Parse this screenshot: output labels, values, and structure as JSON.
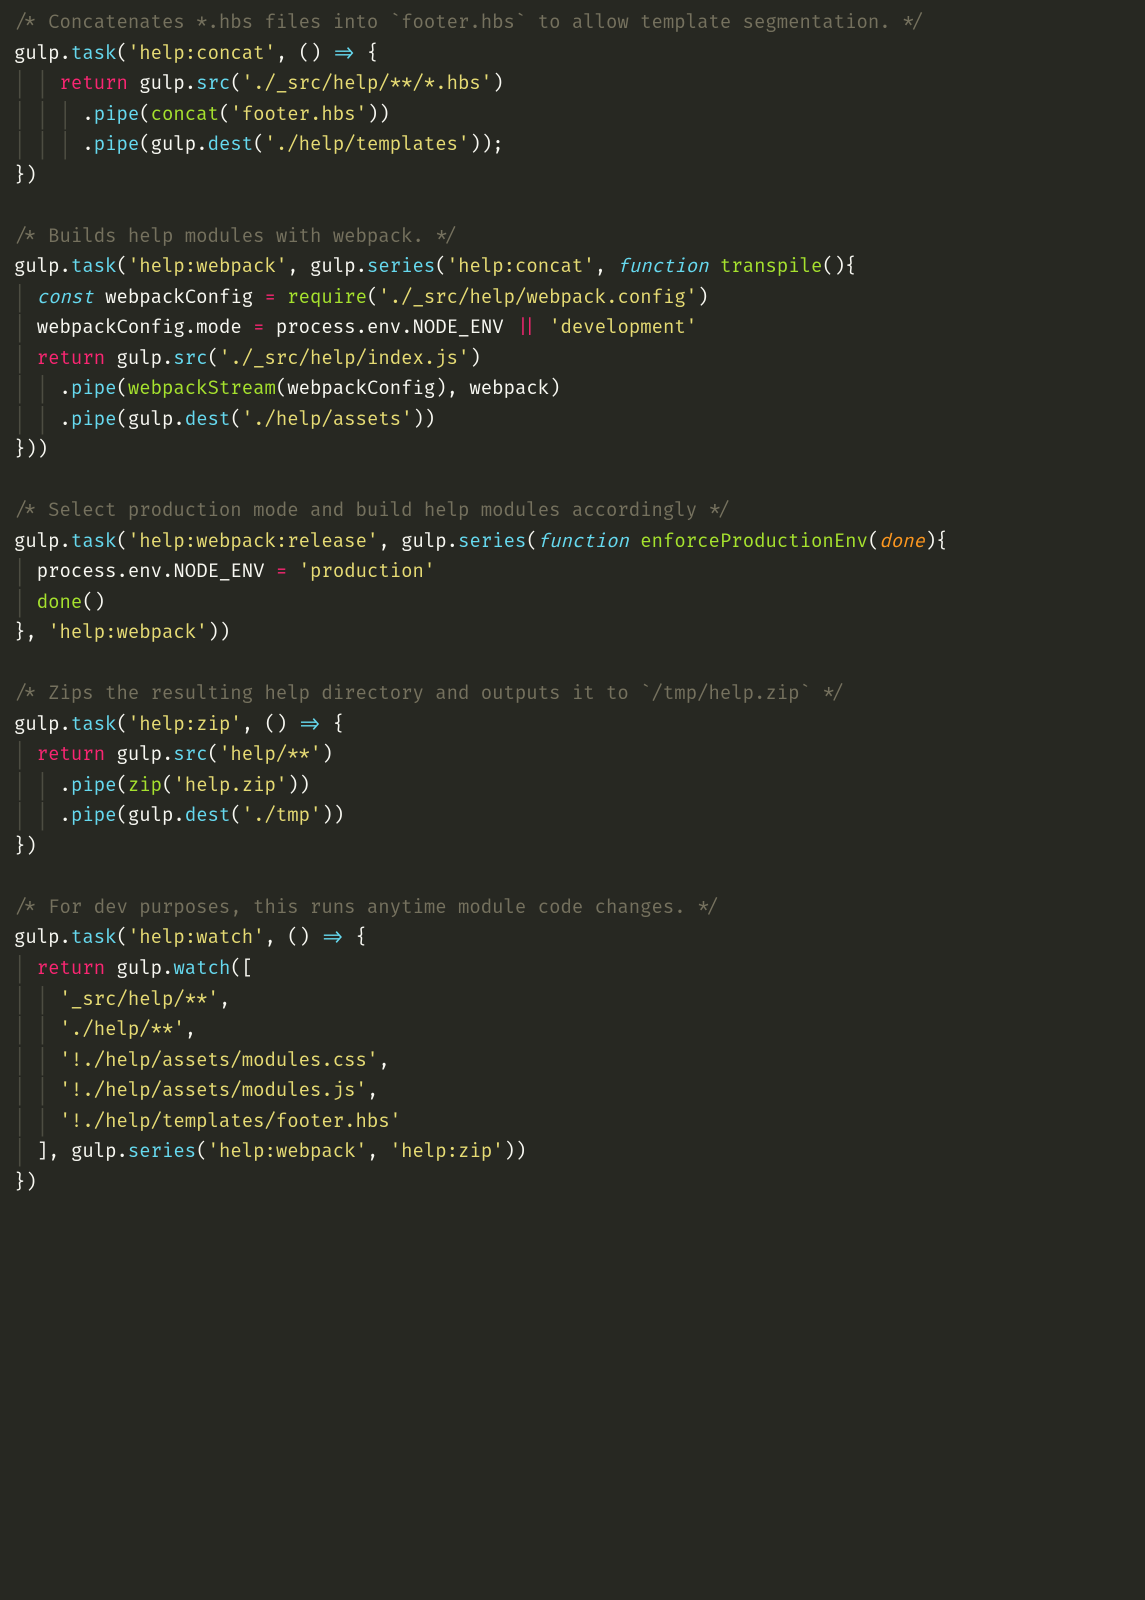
{
  "lines": [
    [
      {
        "cls": "comment",
        "t": "/* Concatenates *.hbs files into `footer.hbs` to allow template segmentation. */"
      }
    ],
    [
      {
        "cls": "ident",
        "t": "gulp"
      },
      {
        "cls": "punct",
        "t": "."
      },
      {
        "cls": "funcname",
        "t": "task"
      },
      {
        "cls": "punct",
        "t": "("
      },
      {
        "cls": "string",
        "t": "'help:concat'"
      },
      {
        "cls": "punct",
        "t": ", () "
      },
      {
        "cls": "arrow",
        "t": "=>"
      },
      {
        "cls": "punct",
        "t": " {"
      }
    ],
    [
      {
        "cls": "indent-guide",
        "t": "│ │ "
      },
      {
        "cls": "ret",
        "t": "return"
      },
      {
        "cls": "ident",
        "t": " gulp"
      },
      {
        "cls": "punct",
        "t": "."
      },
      {
        "cls": "funcname",
        "t": "src"
      },
      {
        "cls": "punct",
        "t": "("
      },
      {
        "cls": "string",
        "t": "'./_src/help/**/*.hbs'"
      },
      {
        "cls": "punct",
        "t": ")"
      }
    ],
    [
      {
        "cls": "indent-guide",
        "t": "│ │ │ "
      },
      {
        "cls": "punct",
        "t": "."
      },
      {
        "cls": "funcname",
        "t": "pipe"
      },
      {
        "cls": "punct",
        "t": "("
      },
      {
        "cls": "func",
        "t": "concat"
      },
      {
        "cls": "punct",
        "t": "("
      },
      {
        "cls": "string",
        "t": "'footer.hbs'"
      },
      {
        "cls": "punct",
        "t": "))"
      }
    ],
    [
      {
        "cls": "indent-guide",
        "t": "│ │ │ "
      },
      {
        "cls": "punct",
        "t": "."
      },
      {
        "cls": "funcname",
        "t": "pipe"
      },
      {
        "cls": "punct",
        "t": "("
      },
      {
        "cls": "ident",
        "t": "gulp"
      },
      {
        "cls": "punct",
        "t": "."
      },
      {
        "cls": "funcname",
        "t": "dest"
      },
      {
        "cls": "punct",
        "t": "("
      },
      {
        "cls": "string",
        "t": "'./help/templates'"
      },
      {
        "cls": "punct",
        "t": "));"
      }
    ],
    [
      {
        "cls": "punct",
        "t": "})"
      }
    ],
    [
      {
        "cls": "",
        "t": ""
      }
    ],
    [
      {
        "cls": "comment",
        "t": "/* Builds help modules with webpack. */"
      }
    ],
    [
      {
        "cls": "ident",
        "t": "gulp"
      },
      {
        "cls": "punct",
        "t": "."
      },
      {
        "cls": "funcname",
        "t": "task"
      },
      {
        "cls": "punct",
        "t": "("
      },
      {
        "cls": "string",
        "t": "'help:webpack'"
      },
      {
        "cls": "punct",
        "t": ", "
      },
      {
        "cls": "ident",
        "t": "gulp"
      },
      {
        "cls": "punct",
        "t": "."
      },
      {
        "cls": "funcname",
        "t": "series"
      },
      {
        "cls": "punct",
        "t": "("
      },
      {
        "cls": "string",
        "t": "'help:concat'"
      },
      {
        "cls": "punct",
        "t": ", "
      },
      {
        "cls": "const",
        "t": "function"
      },
      {
        "cls": "punct",
        "t": " "
      },
      {
        "cls": "func",
        "t": "transpile"
      },
      {
        "cls": "punct",
        "t": "(){"
      }
    ],
    [
      {
        "cls": "indent-guide",
        "t": "│ "
      },
      {
        "cls": "const",
        "t": "const"
      },
      {
        "cls": "ident",
        "t": " webpackConfig "
      },
      {
        "cls": "op",
        "t": "="
      },
      {
        "cls": "ident",
        "t": " "
      },
      {
        "cls": "func",
        "t": "require"
      },
      {
        "cls": "punct",
        "t": "("
      },
      {
        "cls": "string",
        "t": "'./_src/help/webpack.config'"
      },
      {
        "cls": "punct",
        "t": ")"
      }
    ],
    [
      {
        "cls": "indent-guide",
        "t": "│ "
      },
      {
        "cls": "ident",
        "t": "webpackConfig"
      },
      {
        "cls": "punct",
        "t": "."
      },
      {
        "cls": "ident",
        "t": "mode "
      },
      {
        "cls": "op",
        "t": "="
      },
      {
        "cls": "ident",
        "t": " process"
      },
      {
        "cls": "punct",
        "t": "."
      },
      {
        "cls": "ident",
        "t": "env"
      },
      {
        "cls": "punct",
        "t": "."
      },
      {
        "cls": "ident",
        "t": "NODE_ENV "
      },
      {
        "cls": "op",
        "t": "||"
      },
      {
        "cls": "ident",
        "t": " "
      },
      {
        "cls": "string",
        "t": "'development'"
      }
    ],
    [
      {
        "cls": "indent-guide",
        "t": "│ "
      },
      {
        "cls": "ret",
        "t": "return"
      },
      {
        "cls": "ident",
        "t": " gulp"
      },
      {
        "cls": "punct",
        "t": "."
      },
      {
        "cls": "funcname",
        "t": "src"
      },
      {
        "cls": "punct",
        "t": "("
      },
      {
        "cls": "string",
        "t": "'./_src/help/index.js'"
      },
      {
        "cls": "punct",
        "t": ")"
      }
    ],
    [
      {
        "cls": "indent-guide",
        "t": "│ │ "
      },
      {
        "cls": "punct",
        "t": "."
      },
      {
        "cls": "funcname",
        "t": "pipe"
      },
      {
        "cls": "punct",
        "t": "("
      },
      {
        "cls": "func",
        "t": "webpackStream"
      },
      {
        "cls": "punct",
        "t": "(webpackConfig), webpack)"
      }
    ],
    [
      {
        "cls": "indent-guide",
        "t": "│ │ "
      },
      {
        "cls": "punct",
        "t": "."
      },
      {
        "cls": "funcname",
        "t": "pipe"
      },
      {
        "cls": "punct",
        "t": "("
      },
      {
        "cls": "ident",
        "t": "gulp"
      },
      {
        "cls": "punct",
        "t": "."
      },
      {
        "cls": "funcname",
        "t": "dest"
      },
      {
        "cls": "punct",
        "t": "("
      },
      {
        "cls": "string",
        "t": "'./help/assets'"
      },
      {
        "cls": "punct",
        "t": "))"
      }
    ],
    [
      {
        "cls": "punct",
        "t": "}))"
      }
    ],
    [
      {
        "cls": "",
        "t": ""
      }
    ],
    [
      {
        "cls": "comment",
        "t": "/* Select production mode and build help modules accordingly */"
      }
    ],
    [
      {
        "cls": "ident",
        "t": "gulp"
      },
      {
        "cls": "punct",
        "t": "."
      },
      {
        "cls": "funcname",
        "t": "task"
      },
      {
        "cls": "punct",
        "t": "("
      },
      {
        "cls": "string",
        "t": "'help:webpack:release'"
      },
      {
        "cls": "punct",
        "t": ", "
      },
      {
        "cls": "ident",
        "t": "gulp"
      },
      {
        "cls": "punct",
        "t": "."
      },
      {
        "cls": "funcname",
        "t": "series"
      },
      {
        "cls": "punct",
        "t": "("
      },
      {
        "cls": "const",
        "t": "function"
      },
      {
        "cls": "punct",
        "t": " "
      },
      {
        "cls": "func",
        "t": "enforceProductionEnv"
      },
      {
        "cls": "punct",
        "t": "("
      },
      {
        "cls": "param",
        "t": "done"
      },
      {
        "cls": "punct",
        "t": "){"
      }
    ],
    [
      {
        "cls": "indent-guide",
        "t": "│ "
      },
      {
        "cls": "ident",
        "t": "process"
      },
      {
        "cls": "punct",
        "t": "."
      },
      {
        "cls": "ident",
        "t": "env"
      },
      {
        "cls": "punct",
        "t": "."
      },
      {
        "cls": "ident",
        "t": "NODE_ENV "
      },
      {
        "cls": "op",
        "t": "="
      },
      {
        "cls": "ident",
        "t": " "
      },
      {
        "cls": "string",
        "t": "'production'"
      }
    ],
    [
      {
        "cls": "indent-guide",
        "t": "│ "
      },
      {
        "cls": "func",
        "t": "done"
      },
      {
        "cls": "punct",
        "t": "()"
      }
    ],
    [
      {
        "cls": "punct",
        "t": "}, "
      },
      {
        "cls": "string",
        "t": "'help:webpack'"
      },
      {
        "cls": "punct",
        "t": "))"
      }
    ],
    [
      {
        "cls": "",
        "t": ""
      }
    ],
    [
      {
        "cls": "comment",
        "t": "/* Zips the resulting help directory and outputs it to `/tmp/help.zip` */"
      }
    ],
    [
      {
        "cls": "ident",
        "t": "gulp"
      },
      {
        "cls": "punct",
        "t": "."
      },
      {
        "cls": "funcname",
        "t": "task"
      },
      {
        "cls": "punct",
        "t": "("
      },
      {
        "cls": "string",
        "t": "'help:zip'"
      },
      {
        "cls": "punct",
        "t": ", () "
      },
      {
        "cls": "arrow",
        "t": "=>"
      },
      {
        "cls": "punct",
        "t": " {"
      }
    ],
    [
      {
        "cls": "indent-guide",
        "t": "│ "
      },
      {
        "cls": "ret",
        "t": "return"
      },
      {
        "cls": "ident",
        "t": " gulp"
      },
      {
        "cls": "punct",
        "t": "."
      },
      {
        "cls": "funcname",
        "t": "src"
      },
      {
        "cls": "punct",
        "t": "("
      },
      {
        "cls": "string",
        "t": "'help/**'"
      },
      {
        "cls": "punct",
        "t": ")"
      }
    ],
    [
      {
        "cls": "indent-guide",
        "t": "│ │ "
      },
      {
        "cls": "punct",
        "t": "."
      },
      {
        "cls": "funcname",
        "t": "pipe"
      },
      {
        "cls": "punct",
        "t": "("
      },
      {
        "cls": "func",
        "t": "zip"
      },
      {
        "cls": "punct",
        "t": "("
      },
      {
        "cls": "string",
        "t": "'help.zip'"
      },
      {
        "cls": "punct",
        "t": "))"
      }
    ],
    [
      {
        "cls": "indent-guide",
        "t": "│ │ "
      },
      {
        "cls": "punct",
        "t": "."
      },
      {
        "cls": "funcname",
        "t": "pipe"
      },
      {
        "cls": "punct",
        "t": "("
      },
      {
        "cls": "ident",
        "t": "gulp"
      },
      {
        "cls": "punct",
        "t": "."
      },
      {
        "cls": "funcname",
        "t": "dest"
      },
      {
        "cls": "punct",
        "t": "("
      },
      {
        "cls": "string",
        "t": "'./tmp'"
      },
      {
        "cls": "punct",
        "t": "))"
      }
    ],
    [
      {
        "cls": "punct",
        "t": "})"
      }
    ],
    [
      {
        "cls": "",
        "t": ""
      }
    ],
    [
      {
        "cls": "comment",
        "t": "/* For dev purposes, this runs anytime module code changes. */"
      }
    ],
    [
      {
        "cls": "ident",
        "t": "gulp"
      },
      {
        "cls": "punct",
        "t": "."
      },
      {
        "cls": "funcname",
        "t": "task"
      },
      {
        "cls": "punct",
        "t": "("
      },
      {
        "cls": "string",
        "t": "'help:watch'"
      },
      {
        "cls": "punct",
        "t": ", () "
      },
      {
        "cls": "arrow",
        "t": "=>"
      },
      {
        "cls": "punct",
        "t": " {"
      }
    ],
    [
      {
        "cls": "indent-guide",
        "t": "│ "
      },
      {
        "cls": "ret",
        "t": "return"
      },
      {
        "cls": "ident",
        "t": " gulp"
      },
      {
        "cls": "punct",
        "t": "."
      },
      {
        "cls": "funcname",
        "t": "watch"
      },
      {
        "cls": "punct",
        "t": "(["
      }
    ],
    [
      {
        "cls": "indent-guide",
        "t": "│ │ "
      },
      {
        "cls": "string",
        "t": "'_src/help/**'"
      },
      {
        "cls": "punct",
        "t": ","
      }
    ],
    [
      {
        "cls": "indent-guide",
        "t": "│ │ "
      },
      {
        "cls": "string",
        "t": "'./help/**'"
      },
      {
        "cls": "punct",
        "t": ","
      }
    ],
    [
      {
        "cls": "indent-guide",
        "t": "│ │ "
      },
      {
        "cls": "string",
        "t": "'!./help/assets/modules.css'"
      },
      {
        "cls": "punct",
        "t": ","
      }
    ],
    [
      {
        "cls": "indent-guide",
        "t": "│ │ "
      },
      {
        "cls": "string",
        "t": "'!./help/assets/modules.js'"
      },
      {
        "cls": "punct",
        "t": ","
      }
    ],
    [
      {
        "cls": "indent-guide",
        "t": "│ │ "
      },
      {
        "cls": "string",
        "t": "'!./help/templates/footer.hbs'"
      }
    ],
    [
      {
        "cls": "indent-guide",
        "t": "│ "
      },
      {
        "cls": "punct",
        "t": "], "
      },
      {
        "cls": "ident",
        "t": "gulp"
      },
      {
        "cls": "punct",
        "t": "."
      },
      {
        "cls": "funcname",
        "t": "series"
      },
      {
        "cls": "punct",
        "t": "("
      },
      {
        "cls": "string",
        "t": "'help:webpack'"
      },
      {
        "cls": "punct",
        "t": ", "
      },
      {
        "cls": "string",
        "t": "'help:zip'"
      },
      {
        "cls": "punct",
        "t": "))"
      }
    ],
    [
      {
        "cls": "punct",
        "t": "})"
      }
    ]
  ]
}
